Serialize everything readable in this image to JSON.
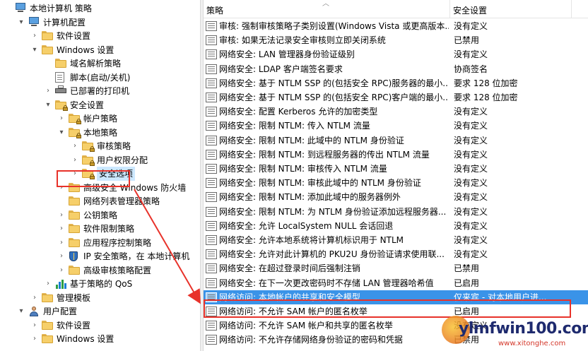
{
  "tree": {
    "nodes": [
      {
        "label": "本地计算机 策略",
        "arrow": "",
        "icon": "computer-icon",
        "indent": 0
      },
      {
        "label": "计算机配置",
        "arrow": "▾",
        "icon": "computer-icon",
        "indent": 1
      },
      {
        "label": "软件设置",
        "arrow": "›",
        "icon": "folder-icon",
        "indent": 2
      },
      {
        "label": "Windows 设置",
        "arrow": "▾",
        "icon": "folder-icon",
        "indent": 2
      },
      {
        "label": "域名解析策略",
        "arrow": "",
        "icon": "folder-icon",
        "indent": 3
      },
      {
        "label": "脚本(启动/关机)",
        "arrow": "",
        "icon": "document-icon",
        "indent": 3
      },
      {
        "label": "已部署的打印机",
        "arrow": "›",
        "icon": "printer-icon",
        "indent": 3
      },
      {
        "label": "安全设置",
        "arrow": "▾",
        "icon": "security-folder-icon",
        "indent": 3
      },
      {
        "label": "帐户策略",
        "arrow": "›",
        "icon": "security-folder-icon",
        "indent": 4
      },
      {
        "label": "本地策略",
        "arrow": "▾",
        "icon": "security-folder-icon",
        "indent": 4
      },
      {
        "label": "审核策略",
        "arrow": "›",
        "icon": "security-folder-icon",
        "indent": 5
      },
      {
        "label": "用户权限分配",
        "arrow": "›",
        "icon": "security-folder-icon",
        "indent": 5
      },
      {
        "label": "安全选项",
        "arrow": "›",
        "icon": "security-folder-icon",
        "indent": 5
      },
      {
        "label": "高级安全 Windows 防火墙",
        "arrow": "›",
        "icon": "folder-icon",
        "indent": 4
      },
      {
        "label": "网络列表管理器策略",
        "arrow": "",
        "icon": "folder-icon",
        "indent": 4
      },
      {
        "label": "公钥策略",
        "arrow": "›",
        "icon": "folder-icon",
        "indent": 4
      },
      {
        "label": "软件限制策略",
        "arrow": "›",
        "icon": "folder-icon",
        "indent": 4
      },
      {
        "label": "应用程序控制策略",
        "arrow": "›",
        "icon": "folder-icon",
        "indent": 4
      },
      {
        "label": "IP 安全策略，在 本地计算机",
        "arrow": "›",
        "icon": "shield-icon",
        "indent": 4
      },
      {
        "label": "高级审核策略配置",
        "arrow": "›",
        "icon": "folder-icon",
        "indent": 4
      },
      {
        "label": "基于策略的 QoS",
        "arrow": "›",
        "icon": "chart-icon",
        "indent": 3
      },
      {
        "label": "管理模板",
        "arrow": "›",
        "icon": "folder-icon",
        "indent": 2
      },
      {
        "label": "用户配置",
        "arrow": "▾",
        "icon": "user-icon",
        "indent": 1
      },
      {
        "label": "软件设置",
        "arrow": "›",
        "icon": "folder-icon",
        "indent": 2
      },
      {
        "label": "Windows 设置",
        "arrow": "›",
        "icon": "folder-icon",
        "indent": 2
      }
    ],
    "selected_index": 12
  },
  "list": {
    "columns": {
      "policy": "策略",
      "setting": "安全设置"
    },
    "rows": [
      {
        "policy": "审核: 强制审核策略子类别设置(Windows Vista 或更高版本...",
        "setting": "没有定义"
      },
      {
        "policy": "审核: 如果无法记录安全审核则立即关闭系统",
        "setting": "已禁用"
      },
      {
        "policy": "网络安全: LAN 管理器身份验证级别",
        "setting": "没有定义"
      },
      {
        "policy": "网络安全: LDAP 客户端签名要求",
        "setting": "协商签名"
      },
      {
        "policy": "网络安全: 基于 NTLM SSP 的(包括安全 RPC)服务器的最小...",
        "setting": "要求 128 位加密"
      },
      {
        "policy": "网络安全: 基于 NTLM SSP 的(包括安全 RPC)客户端的最小...",
        "setting": "要求 128 位加密"
      },
      {
        "policy": "网络安全: 配置 Kerberos 允许的加密类型",
        "setting": "没有定义"
      },
      {
        "policy": "网络安全: 限制 NTLM: 传入 NTLM 流量",
        "setting": "没有定义"
      },
      {
        "policy": "网络安全: 限制 NTLM: 此域中的 NTLM 身份验证",
        "setting": "没有定义"
      },
      {
        "policy": "网络安全: 限制 NTLM: 到远程服务器的传出 NTLM 流量",
        "setting": "没有定义"
      },
      {
        "policy": "网络安全: 限制 NTLM: 审核传入 NTLM 流量",
        "setting": "没有定义"
      },
      {
        "policy": "网络安全: 限制 NTLM: 审核此域中的 NTLM 身份验证",
        "setting": "没有定义"
      },
      {
        "policy": "网络安全: 限制 NTLM: 添加此域中的服务器例外",
        "setting": "没有定义"
      },
      {
        "policy": "网络安全: 限制 NTLM: 为 NTLM 身份验证添加远程服务器...",
        "setting": "没有定义"
      },
      {
        "policy": "网络安全: 允许 LocalSystem NULL 会话回退",
        "setting": "没有定义"
      },
      {
        "policy": "网络安全: 允许本地系统将计算机标识用于 NTLM",
        "setting": "没有定义"
      },
      {
        "policy": "网络安全: 允许对此计算机的 PKU2U 身份验证请求使用联...",
        "setting": "没有定义"
      },
      {
        "policy": "网络安全: 在超过登录时间后强制注销",
        "setting": "已禁用"
      },
      {
        "policy": "网络安全: 在下一次更改密码时不存储 LAN 管理器哈希值",
        "setting": "已启用"
      },
      {
        "policy": "网络访问: 本地帐户的共享和安全模型",
        "setting": "仅来宾 - 对本地用户进..."
      },
      {
        "policy": "网络访问: 不允许 SAM 帐户的匿名枚举",
        "setting": "已启用"
      },
      {
        "policy": "网络访问: 不允许 SAM 帐户和共享的匿名枚举",
        "setting": "没有定义"
      },
      {
        "policy": "网络访问: 不允许存储网络身份验证的密码和凭据",
        "setting": "已禁用"
      }
    ],
    "selected_index": 19
  },
  "watermark": {
    "text": "ylmfwin100.com",
    "sub": "www.xitonghe.com"
  },
  "colors": {
    "selection": "#3a93e8",
    "annotation_red": "#e8322a",
    "tree_selected": "#cce8ff"
  }
}
